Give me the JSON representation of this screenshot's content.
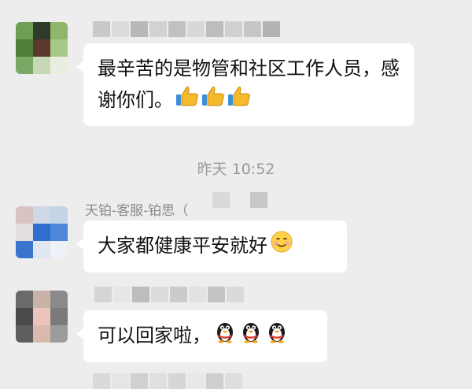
{
  "chat": {
    "timestamp": "昨天 10:52",
    "messages": [
      {
        "sender": "",
        "text": "最辛苦的是物管和社区工作人员，感谢你们。",
        "emoji": [
          "thumbs-up-icon",
          "thumbs-up-icon",
          "thumbs-up-icon"
        ]
      },
      {
        "sender": "天铂-客服-铂思（",
        "text": "大家都健康平安就好",
        "emoji": [
          "smiling-face-icon"
        ]
      },
      {
        "sender": "",
        "text": "可以回家啦，",
        "emoji": [
          "penguin-icon",
          "penguin-icon",
          "penguin-icon"
        ]
      }
    ]
  },
  "colors": {
    "background": "#ededed",
    "bubble": "#ffffff",
    "timestamp_text": "#9a9a9a",
    "sender_text": "#8a8a8a"
  }
}
